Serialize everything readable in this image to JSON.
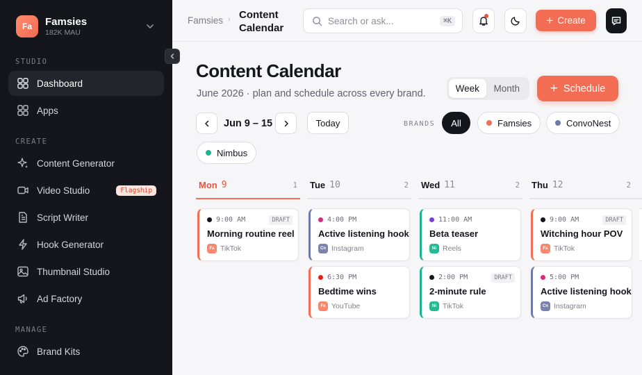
{
  "workspace": {
    "initials": "Fa",
    "name": "Famsies",
    "sub": "182K MAU"
  },
  "sidebar": {
    "sections": [
      {
        "label": "STUDIO",
        "items": [
          {
            "label": "Dashboard",
            "icon": "grid-icon",
            "active": true
          },
          {
            "label": "Apps",
            "icon": "apps-icon"
          }
        ]
      },
      {
        "label": "CREATE",
        "items": [
          {
            "label": "Content Generator",
            "icon": "sparkle-icon"
          },
          {
            "label": "Video Studio",
            "icon": "video-icon",
            "badge": "Flagship"
          },
          {
            "label": "Script Writer",
            "icon": "document-icon"
          },
          {
            "label": "Hook Generator",
            "icon": "bolt-icon"
          },
          {
            "label": "Thumbnail Studio",
            "icon": "image-icon"
          },
          {
            "label": "Ad Factory",
            "icon": "megaphone-icon"
          }
        ]
      },
      {
        "label": "MANAGE",
        "items": [
          {
            "label": "Brand Kits",
            "icon": "palette-icon"
          }
        ]
      }
    ]
  },
  "topbar": {
    "crumb_root": "Famsies",
    "crumb_current": "Content Calendar",
    "search_placeholder": "Search or ask...",
    "search_shortcut": "⌘K",
    "create_label": "Create"
  },
  "page": {
    "title": "Content Calendar",
    "subtitle": "June 2026 · plan and schedule across every brand.",
    "view_toggle": {
      "week": "Week",
      "month": "Month",
      "selected": "Week"
    },
    "schedule_label": "Schedule",
    "range": "Jun 9 – 15",
    "today_label": "Today",
    "brands_label": "BRANDS",
    "brand_filters": [
      {
        "label": "All",
        "selected": true
      },
      {
        "label": "Famsies",
        "color": "#f26e56"
      },
      {
        "label": "ConvoNest",
        "color": "#6f7aa8"
      },
      {
        "label": "Nimbus",
        "color": "#1fb28f"
      }
    ]
  },
  "calendar": {
    "days": [
      {
        "day": "Mon",
        "date": "9",
        "count": "1",
        "today": true,
        "events": [
          {
            "time": "9:00 AM",
            "draft": true,
            "title": "Morning routine reel",
            "platform": "TikTok",
            "brand": "Fa",
            "accent": "#f26e56",
            "dot": "#15161c"
          }
        ]
      },
      {
        "day": "Tue",
        "date": "10",
        "count": "2",
        "events": [
          {
            "time": "4:00 PM",
            "draft": false,
            "title": "Active listening hook",
            "platform": "Instagram",
            "brand": "Cn",
            "accent": "#6f7aa8",
            "dot": "#d62c7e"
          },
          {
            "time": "6:30 PM",
            "draft": false,
            "title": "Bedtime wins",
            "platform": "YouTube",
            "brand": "Fa",
            "accent": "#f26e56",
            "dot": "#e0201a"
          }
        ]
      },
      {
        "day": "Wed",
        "date": "11",
        "count": "2",
        "events": [
          {
            "time": "11:00 AM",
            "draft": false,
            "title": "Beta teaser",
            "platform": "Reels",
            "brand": "Ni",
            "accent": "#1fb28f",
            "dot": "#7b3fe0"
          },
          {
            "time": "2:00 PM",
            "draft": true,
            "title": "2-minute rule",
            "platform": "TikTok",
            "brand": "Ni",
            "accent": "#1fb28f",
            "dot": "#15161c"
          }
        ]
      },
      {
        "day": "Thu",
        "date": "12",
        "count": "2",
        "events": [
          {
            "time": "9:00 AM",
            "draft": true,
            "title": "Witching hour POV",
            "platform": "TikTok",
            "brand": "Fa",
            "accent": "#f26e56",
            "dot": "#15161c"
          },
          {
            "time": "5:00 PM",
            "draft": false,
            "title": "Active listening hook",
            "platform": "Instagram",
            "brand": "Cn",
            "accent": "#6f7aa8",
            "dot": "#d62c7e"
          }
        ]
      }
    ],
    "draft_label": "DRAFT"
  },
  "colors": {
    "accent": "#f36d55",
    "sidebar_bg": "#15161c",
    "page_bg": "#f6f6f8"
  }
}
